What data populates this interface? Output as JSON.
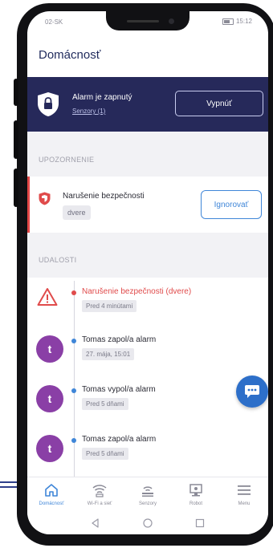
{
  "status_bar": {
    "carrier": "02-SK",
    "time": "15:12"
  },
  "header": {
    "title": "Domácnosť"
  },
  "alarm": {
    "status": "Alarm je zapnutý",
    "sensors_link": "Senzory (1)",
    "off_button": "Vypnúť"
  },
  "warnings": {
    "section_title": "UPOZORNENIE",
    "items": [
      {
        "title": "Narušenie bezpečnosti",
        "chip": "dvere",
        "ignore_button": "Ignorovať"
      }
    ]
  },
  "events": {
    "section_title": "UDALOSTI",
    "items": [
      {
        "type": "alert",
        "title": "Narušenie bezpečnosti (dvere)",
        "time": "Pred 4 minútami"
      },
      {
        "type": "user",
        "avatar": "t",
        "title": "Tomas zapol/a alarm",
        "time": "27. mája, 15:01"
      },
      {
        "type": "user",
        "avatar": "t",
        "title": "Tomas vypol/a alarm",
        "time": "Pred 5 dňami"
      },
      {
        "type": "user",
        "avatar": "t",
        "title": "Tomas zapol/a alarm",
        "time": "Pred 5 dňami"
      }
    ]
  },
  "bottom_nav": {
    "items": [
      {
        "label": "Domácnosť",
        "icon": "home-icon",
        "active": true
      },
      {
        "label": "Wi-Fi a sieť",
        "icon": "wifi-icon",
        "active": false
      },
      {
        "label": "Senzory",
        "icon": "sensor-icon",
        "active": false
      },
      {
        "label": "Robot",
        "icon": "robot-icon",
        "active": false
      },
      {
        "label": "Menu",
        "icon": "menu-icon",
        "active": false
      }
    ]
  },
  "colors": {
    "brand_dark": "#26295a",
    "accent_blue": "#3f86d8",
    "alert_red": "#e04b4b",
    "avatar_purple": "#8a3fa6"
  }
}
